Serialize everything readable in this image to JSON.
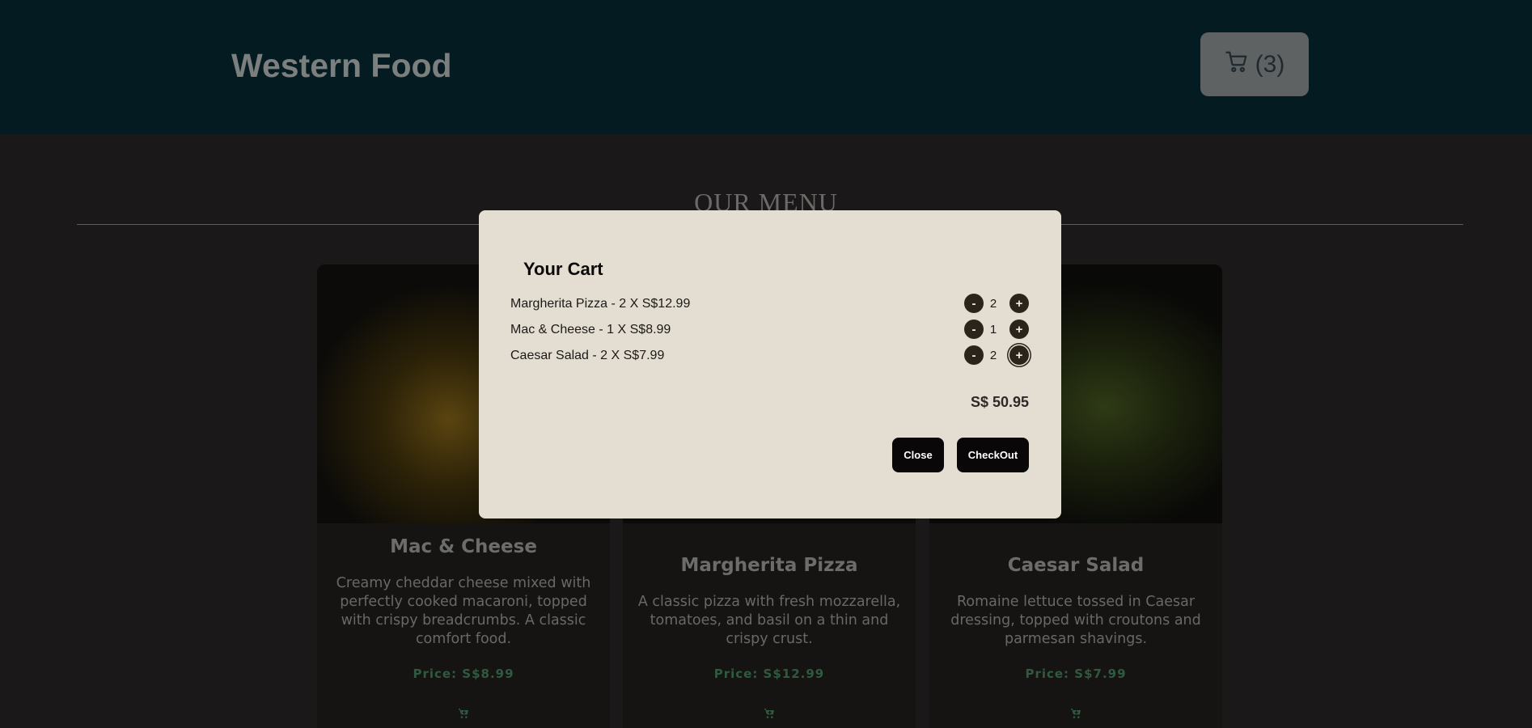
{
  "header": {
    "brand": "Western Food",
    "cart_count": "(3)",
    "colors": {
      "background": "#051b22",
      "cart_button": "#5f6263"
    }
  },
  "menu": {
    "title": "OUR MENU",
    "items": [
      {
        "name": "Mac & Cheese",
        "description": "Creamy cheddar cheese mixed with perfectly cooked macaroni, topped with crispy breadcrumbs. A classic comfort food.",
        "price": "Price: S$8.99",
        "icon": "cart-add-icon"
      },
      {
        "name": "Margherita Pizza",
        "description": "A classic pizza with fresh mozzarella, tomatoes, and basil on a thin and crispy crust.",
        "price": "Price: S$12.99",
        "icon": "cart-add-icon"
      },
      {
        "name": "Caesar Salad",
        "description": "Romaine lettuce tossed in Caesar dressing, topped with croutons and parmesan shavings.",
        "price": "Price: S$7.99",
        "icon": "cart-add-icon"
      }
    ]
  },
  "cart": {
    "title": "Your Cart",
    "items": [
      {
        "label": "Margherita Pizza - 2 X S$12.99",
        "qty": "2",
        "minus": "-",
        "plus": "+"
      },
      {
        "label": "Mac & Cheese - 1 X S$8.99",
        "qty": "1",
        "minus": "-",
        "plus": "+"
      },
      {
        "label": "Caesar Salad - 2 X S$7.99",
        "qty": "2",
        "minus": "-",
        "plus": "+"
      }
    ],
    "total": "S$ 50.95",
    "close_label": "Close",
    "checkout_label": "CheckOut",
    "colors": {
      "modal_bg": "#e4ddd2",
      "button_bg": "#0a0708",
      "qty_button_bg": "#2b241b"
    }
  }
}
